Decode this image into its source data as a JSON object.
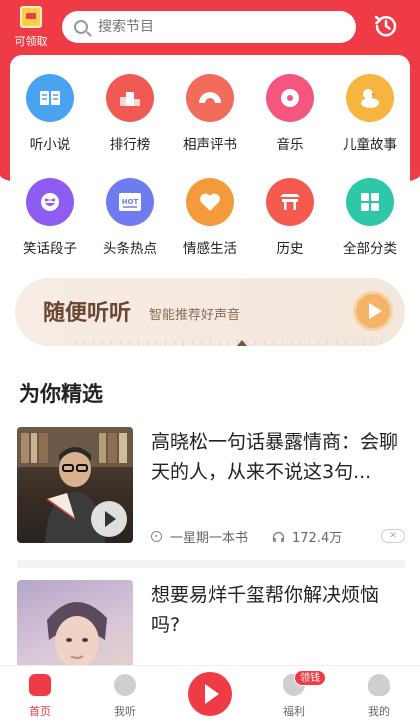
{
  "header": {
    "coupon_label": "可领取",
    "search_placeholder": "搜索节目"
  },
  "categories": [
    {
      "label": "听小说",
      "color": "#4aa3f0",
      "icon": "book-icon"
    },
    {
      "label": "排行榜",
      "color": "#f05a55",
      "icon": "podium-icon"
    },
    {
      "label": "相声评书",
      "color": "#f26b5b",
      "icon": "fan-icon"
    },
    {
      "label": "音乐",
      "color": "#f5567f",
      "icon": "music-note-icon"
    },
    {
      "label": "儿童故事",
      "color": "#f6b53e",
      "icon": "duck-icon"
    },
    {
      "label": "笑话段子",
      "color": "#8e5cf0",
      "icon": "laugh-face-icon"
    },
    {
      "label": "头条热点",
      "color": "#6f7cf0",
      "icon": "hot-news-icon"
    },
    {
      "label": "情感生活",
      "color": "#f59a3c",
      "icon": "heart-icon"
    },
    {
      "label": "历史",
      "color": "#f45a4d",
      "icon": "temple-icon"
    },
    {
      "label": "全部分类",
      "color": "#2ec7a7",
      "icon": "grid-icon"
    }
  ],
  "banner": {
    "title": "随便听听",
    "subtitle": "智能推荐好声音"
  },
  "section_title": "为你精选",
  "items": [
    {
      "title": "高晓松一句话暴露情商：会聊天的人，从来不说这3句...",
      "album": "一星期一本书",
      "plays": "172.4万"
    },
    {
      "title": "想要易烊千玺帮你解决烦恼吗?"
    }
  ],
  "tabbar": {
    "home": "首页",
    "listen": "我听",
    "welfare": "福利",
    "earn_badge": "领钱",
    "mine": "我的"
  },
  "colors": {
    "brand_red": "#ef3b45"
  }
}
